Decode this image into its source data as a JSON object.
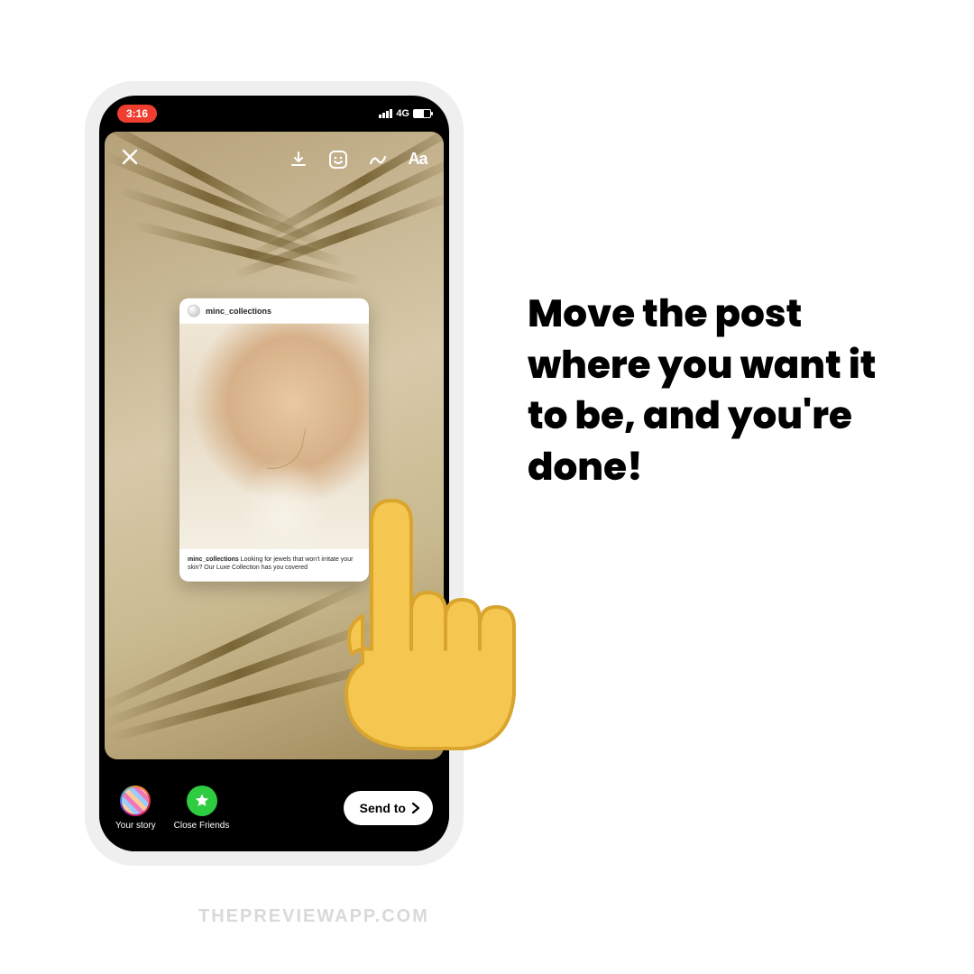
{
  "status": {
    "time": "3:16",
    "network": "4G"
  },
  "editor": {
    "text_tool": "Aa"
  },
  "post": {
    "username": "minc_collections",
    "caption_user": "minc_collections",
    "caption_text": "Looking for jewels that won't irritate your skin? Our Luxe Collection has you covered"
  },
  "actions": {
    "your_story": "Your story",
    "close_friends": "Close Friends",
    "send_to": "Send to"
  },
  "side_caption": "Move the post where you want it to be, and you're done!",
  "watermark": "THEPREVIEWAPP.COM"
}
